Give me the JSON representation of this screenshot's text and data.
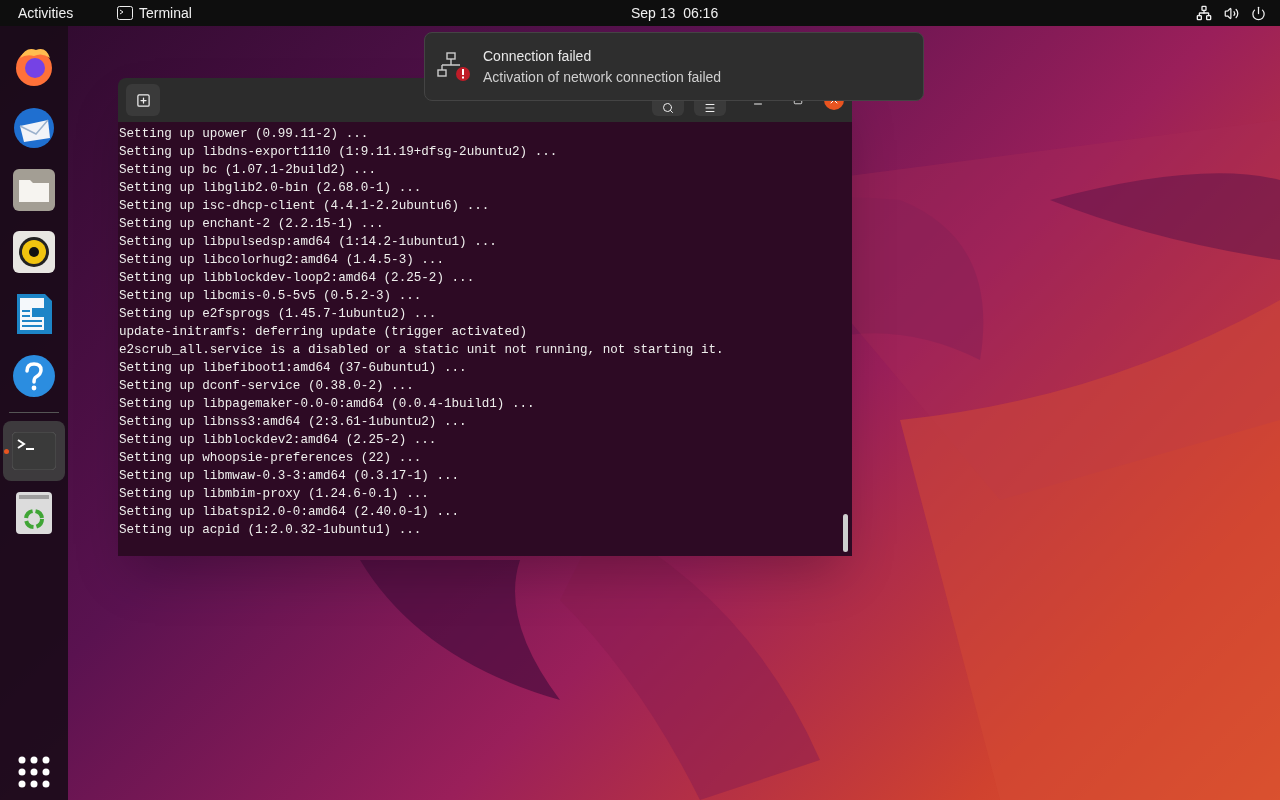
{
  "top_bar": {
    "activities": "Activities",
    "app_name": "Terminal",
    "clock": "Sep 13  06:16"
  },
  "dock": {
    "items": [
      {
        "kind": "browser",
        "selected": false,
        "running": false
      },
      {
        "kind": "mail",
        "selected": false,
        "running": false
      },
      {
        "kind": "files",
        "selected": false,
        "running": false
      },
      {
        "kind": "music",
        "selected": false,
        "running": false
      },
      {
        "kind": "writer",
        "selected": false,
        "running": false
      },
      {
        "kind": "help",
        "selected": false,
        "running": false
      },
      {
        "kind": "terminal",
        "selected": true,
        "running": true
      },
      {
        "kind": "trash",
        "selected": false,
        "running": false
      }
    ]
  },
  "terminal": {
    "lines": [
      "Setting up upower (0.99.11-2) ...",
      "Setting up libdns-export1110 (1:9.11.19+dfsg-2ubuntu2) ...",
      "Setting up bc (1.07.1-2build2) ...",
      "Setting up libglib2.0-bin (2.68.0-1) ...",
      "Setting up isc-dhcp-client (4.4.1-2.2ubuntu6) ...",
      "Setting up enchant-2 (2.2.15-1) ...",
      "Setting up libpulsedsp:amd64 (1:14.2-1ubuntu1) ...",
      "Setting up libcolorhug2:amd64 (1.4.5-3) ...",
      "Setting up libblockdev-loop2:amd64 (2.25-2) ...",
      "Setting up libcmis-0.5-5v5 (0.5.2-3) ...",
      "Setting up e2fsprogs (1.45.7-1ubuntu2) ...",
      "update-initramfs: deferring update (trigger activated)",
      "e2scrub_all.service is a disabled or a static unit not running, not starting it.",
      "Setting up libefiboot1:amd64 (37-6ubuntu1) ...",
      "Setting up dconf-service (0.38.0-2) ...",
      "Setting up libpagemaker-0.0-0:amd64 (0.0.4-1build1) ...",
      "Setting up libnss3:amd64 (2:3.61-1ubuntu2) ...",
      "Setting up libblockdev2:amd64 (2.25-2) ...",
      "Setting up whoopsie-preferences (22) ...",
      "Setting up libmwaw-0.3-3:amd64 (0.3.17-1) ...",
      "Setting up libmbim-proxy (1.24.6-0.1) ...",
      "Setting up libatspi2.0-0:amd64 (2.40.0-1) ...",
      "Setting up acpid (1:2.0.32-1ubuntu1) ..."
    ]
  },
  "notification": {
    "title": "Connection failed",
    "body": "Activation of network connection failed"
  }
}
